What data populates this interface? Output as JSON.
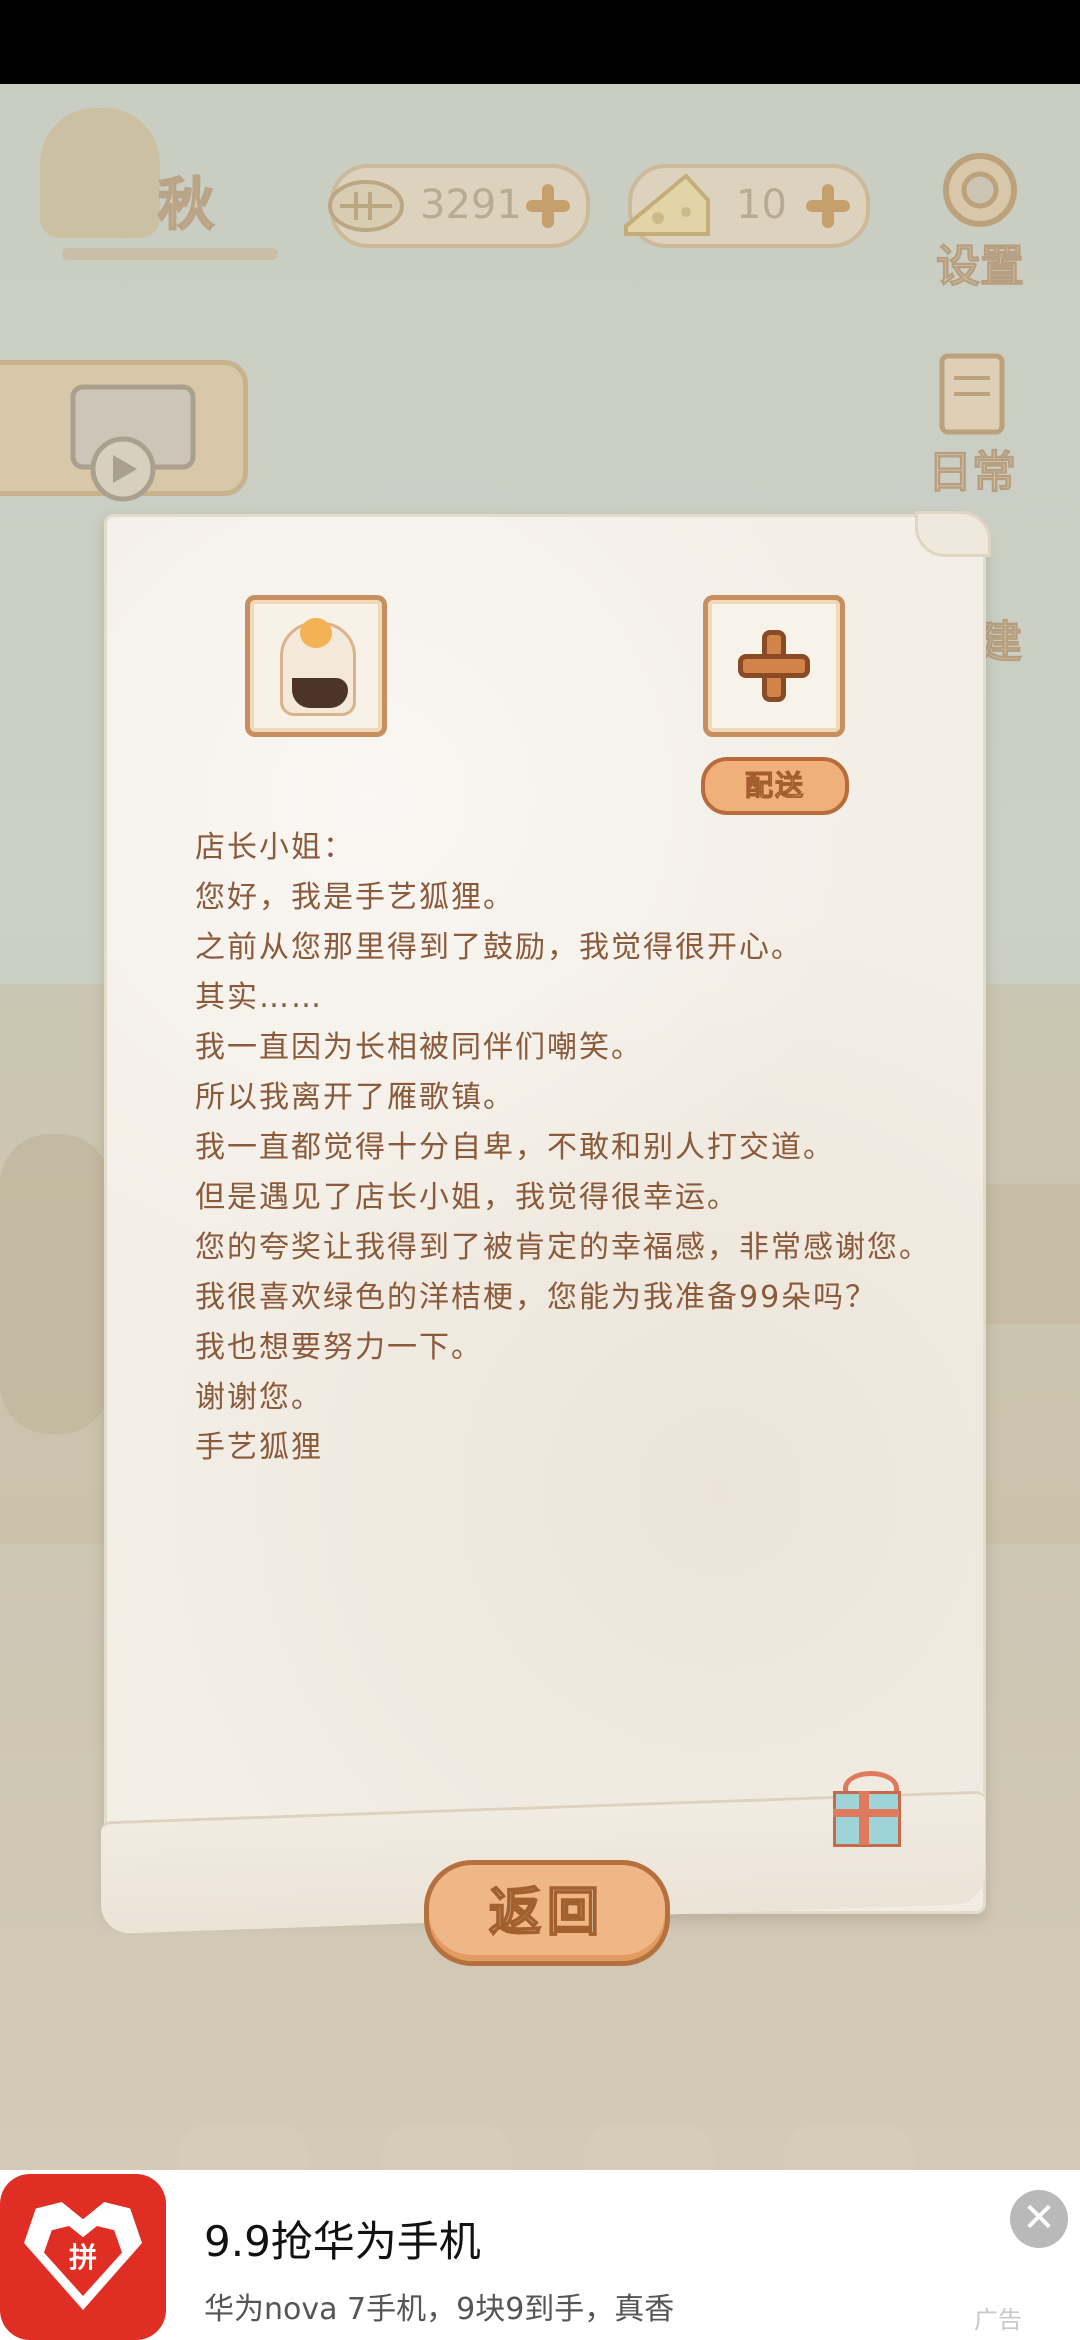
{
  "hud": {
    "season": "秋",
    "fish_count": "3291",
    "cheese_count": "10",
    "settings_label": "设置",
    "daily_label": "日常",
    "build_label": "建"
  },
  "letter": {
    "deliver_label": "配送",
    "lines": [
      "店长小姐：",
      "您好，我是手艺狐狸。",
      "之前从您那里得到了鼓励，我觉得很开心。",
      "其实……",
      "我一直因为长相被同伴们嘲笑。",
      "所以我离开了雁歌镇。",
      "我一直都觉得十分自卑，不敢和别人打交道。",
      "但是遇见了店长小姐，我觉得很幸运。",
      "您的夸奖让我得到了被肯定的幸福感，非常感谢您。",
      "我很喜欢绿色的洋桔梗，您能为我准备99朵吗？",
      "我也想要努力一下。",
      "谢谢您。",
      "手艺狐狸"
    ],
    "back_label": "返回"
  },
  "ad": {
    "logo_char": "拼",
    "title": "9.9抢华为手机",
    "subtitle": "华为nova 7手机，9块9到手，真香",
    "close": "✕",
    "tag": "广告"
  }
}
